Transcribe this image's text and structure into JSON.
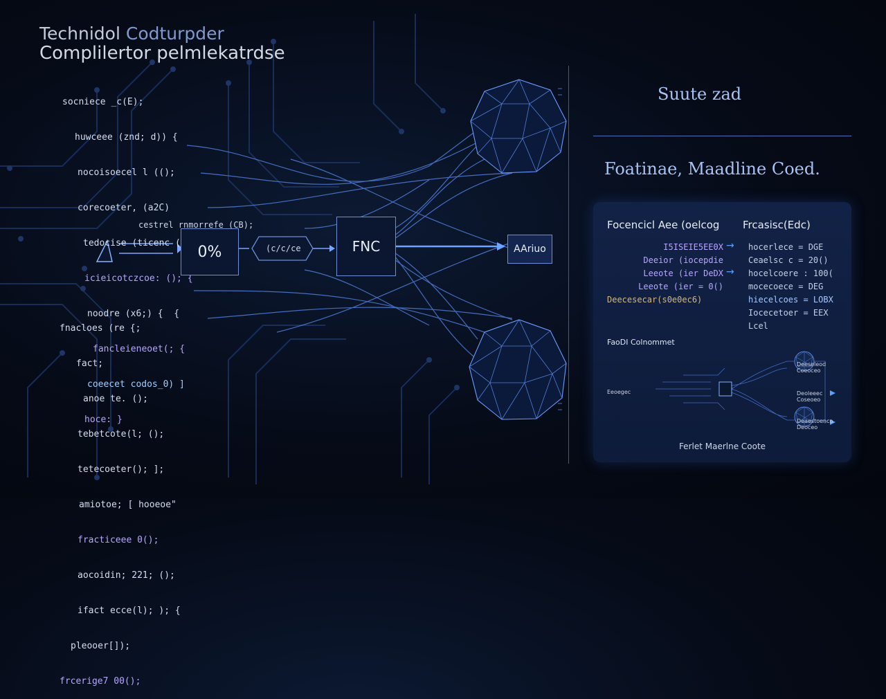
{
  "title": {
    "line1_a": "Technidol",
    "line1_b": "Codturpder",
    "line2": "Complilertor pelmlekatrdse"
  },
  "code_top": [
    "socniece _c(E);",
    "huwceee (znd; d)) {",
    "nocoisoecel l (();",
    "corecoeter, (a2C)",
    "tedocise (ticenc ();",
    "icieicotczcoe: (); {",
    "noodre (x6;) {  {",
    "fancleieneoet(; {",
    "coeecet codos_0) ]",
    "hoce: }"
  ],
  "code_bottom": [
    "fnacloes (re {;",
    "fact;",
    "anoe te. ();",
    "tebetcote(l; ();",
    "tetecoeter(); ];",
    "amiotoe; [ hooeoe\"",
    "fracticeee 0();",
    "aocoidin; 221; ();",
    "ifact ecce(l); ); {",
    "pleooer[]);",
    "frcerige7 00();"
  ],
  "flow": {
    "label_above": "cestrel  rnmorrefe (CB);",
    "box_percent": "0%",
    "hex_label": "(c/c/ce",
    "center_box": "FNC",
    "out_box": "AAriuo"
  },
  "right": {
    "subtitle": "Suute zad",
    "heading": "Foatinae, Maadline Coed.",
    "panel": {
      "col_left_title": "Focencicl Aee (oelcog",
      "col_right_title": "Frcasisc(Edc)",
      "left_rows": [
        "I5ISEIE5EE0X",
        "Deeior (iocepdie",
        "Leeote (ier DeDX",
        "Leeote (ier = 0()",
        "Deecesecar(s0e0ec6)"
      ],
      "right_rows": [
        "hocerlece = DGE",
        "Ceaelsc c = 20()",
        "hocelcoere : 100(",
        "mocecoece = DEG",
        "hiecelcoes = LOBX",
        "Iocecetoer = EEX",
        "Lcel"
      ],
      "mini_title": "FaoDI Colnommet",
      "mini_left": "Eeoegec",
      "mini_right": [
        "Deeseleod Coeoceo",
        "Deoleeec Coseoeo",
        "Deaestoenco Deoceo"
      ],
      "caption": "Ferlet Maerlne Coote"
    }
  },
  "colors": {
    "accent": "#5a9dff",
    "line": "#3b6fd8",
    "panel": "#122246",
    "code_keyword": "#b7a6ff"
  }
}
